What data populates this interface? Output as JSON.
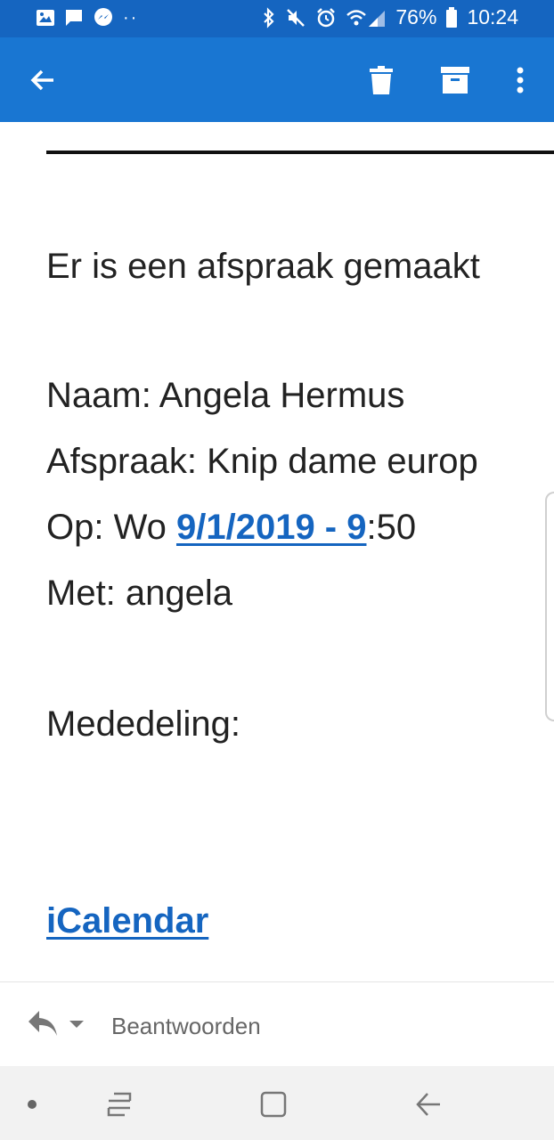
{
  "status_bar": {
    "battery_percent": "76%",
    "time": "10:24"
  },
  "app_bar": {
    "back_icon": "arrow-left-icon",
    "delete_icon": "trash-icon",
    "archive_icon": "archive-icon",
    "more_icon": "more-vert-icon"
  },
  "email": {
    "intro": "Er is een afspraak gemaakt",
    "name_line": "Naam: Angela Hermus",
    "appointment_line": "Afspraak: Knip dame europ",
    "date_prefix": "Op: Wo ",
    "date_link": "9/1/2019 - 9",
    "date_suffix": ":50",
    "with_line": "Met: angela",
    "notice_line": "Mededeling:",
    "calendar_link": "iCalendar"
  },
  "reply_bar": {
    "reply_label": "Beantwoorden"
  },
  "colors": {
    "status_bar": "#1565c0",
    "app_bar": "#1976d2",
    "link": "#1565c0"
  }
}
